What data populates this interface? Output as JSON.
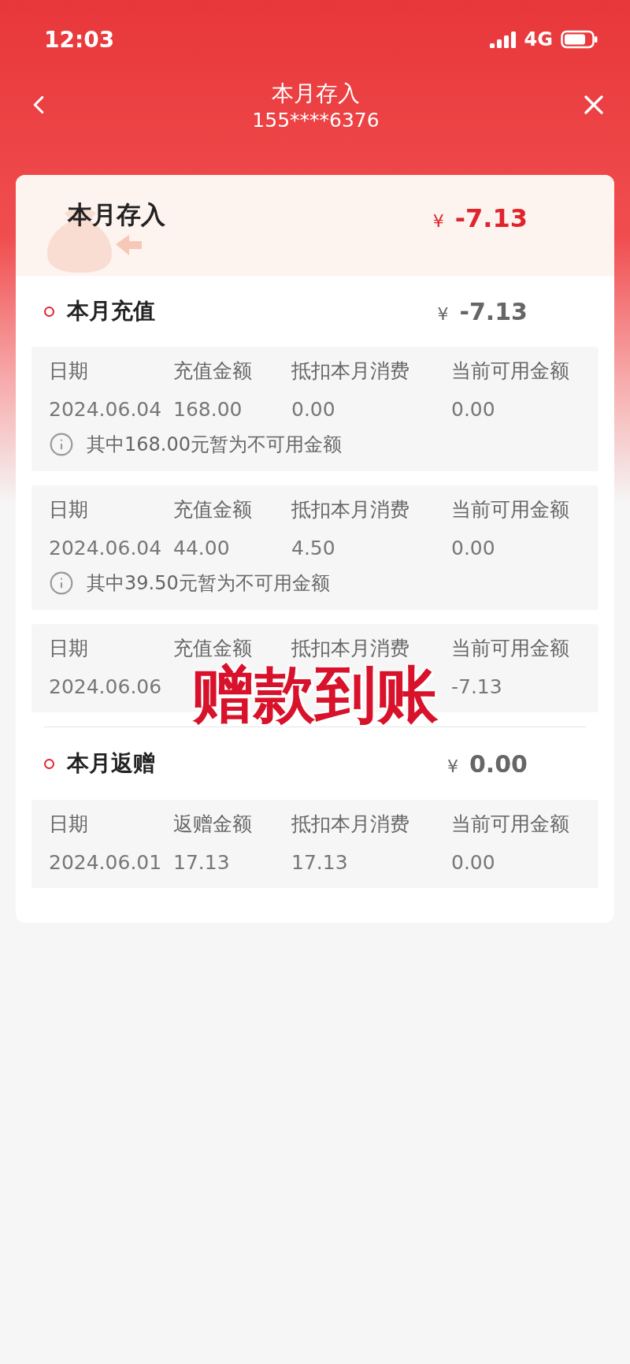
{
  "status_bar": {
    "time": "12:03",
    "network": "4G"
  },
  "header": {
    "title": "本月存入",
    "subtitle": "155****6376"
  },
  "summary": {
    "title": "本月存入",
    "currency": "¥",
    "amount": "-7.13"
  },
  "sections": [
    {
      "title": "本月充值",
      "currency": "¥",
      "amount": "-7.13",
      "divider": false,
      "records": [
        {
          "columns": [
            "日期",
            "充值金额",
            "抵扣本月消费",
            "当前可用金额"
          ],
          "values": {
            "date": "2024.06.04",
            "amount": "168.00",
            "deduct": "0.00",
            "available": "0.00"
          },
          "note": "其中168.00元暂为不可用金额"
        },
        {
          "columns": [
            "日期",
            "充值金额",
            "抵扣本月消费",
            "当前可用金额"
          ],
          "values": {
            "date": "2024.06.04",
            "amount": "44.00",
            "deduct": "4.50",
            "available": "0.00"
          },
          "note": "其中39.50元暂为不可用金额"
        },
        {
          "columns": [
            "日期",
            "充值金额",
            "抵扣本月消费",
            "当前可用金额"
          ],
          "values": {
            "date": "2024.06.06",
            "available": "-7.13"
          },
          "caption": "赠款到账"
        }
      ]
    },
    {
      "title": "本月返赠",
      "currency": "¥",
      "amount": "0.00",
      "divider": true,
      "records": [
        {
          "columns": [
            "日期",
            "返赠金额",
            "抵扣本月消费",
            "当前可用金额"
          ],
          "values": {
            "date": "2024.06.01",
            "amount": "17.13",
            "deduct": "17.13",
            "available": "0.00"
          }
        }
      ]
    }
  ]
}
